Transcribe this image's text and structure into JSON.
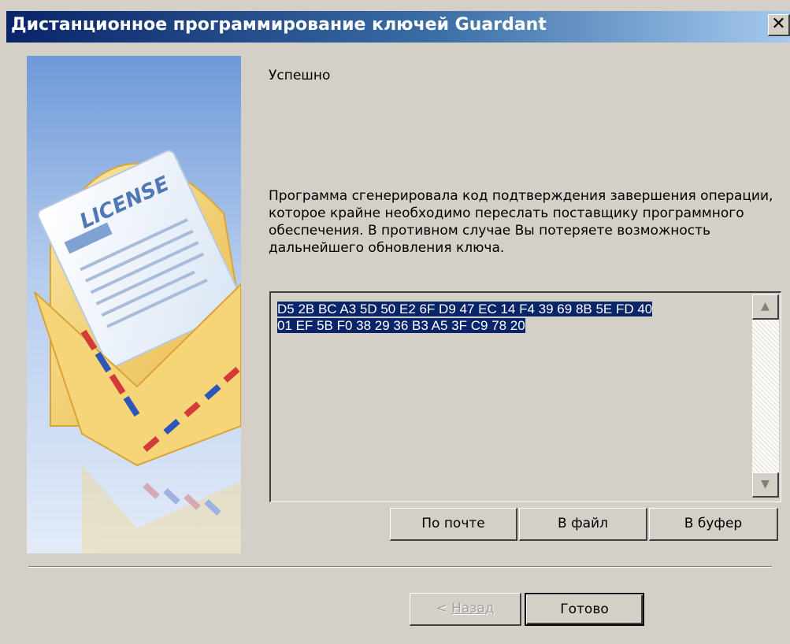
{
  "window": {
    "title": "Дистанционное программирование ключей Guardant",
    "close_label": "✕"
  },
  "banner": {
    "license_text": "LICENSE"
  },
  "content": {
    "heading": "Успешно",
    "message": "Программа сгенерировала код подтверждения завершения операции, которое крайне необходимо переслать поставщику программного обеспечения. В противном случае Вы потеряете возможность дальнейшего обновления ключа.",
    "code_line1": "D5 2B BC A3 5D 50 E2 6F D9 47 EC 14 F4 39 69 8B 5E FD 40",
    "code_line2": "01 EF 5B F0 38 29 36 B3 A5 3F C9 78 20"
  },
  "actions": {
    "by_mail": "По почте",
    "to_file": "В файл",
    "to_buffer": "В буфер"
  },
  "footer": {
    "back_prefix": "< ",
    "back_label": "Назад",
    "finish_label": "Готово"
  },
  "colors": {
    "title_start": "#0a246a",
    "title_end": "#a6caf0",
    "dialog_bg": "#d4d0c8",
    "selection": "#0a246a"
  }
}
